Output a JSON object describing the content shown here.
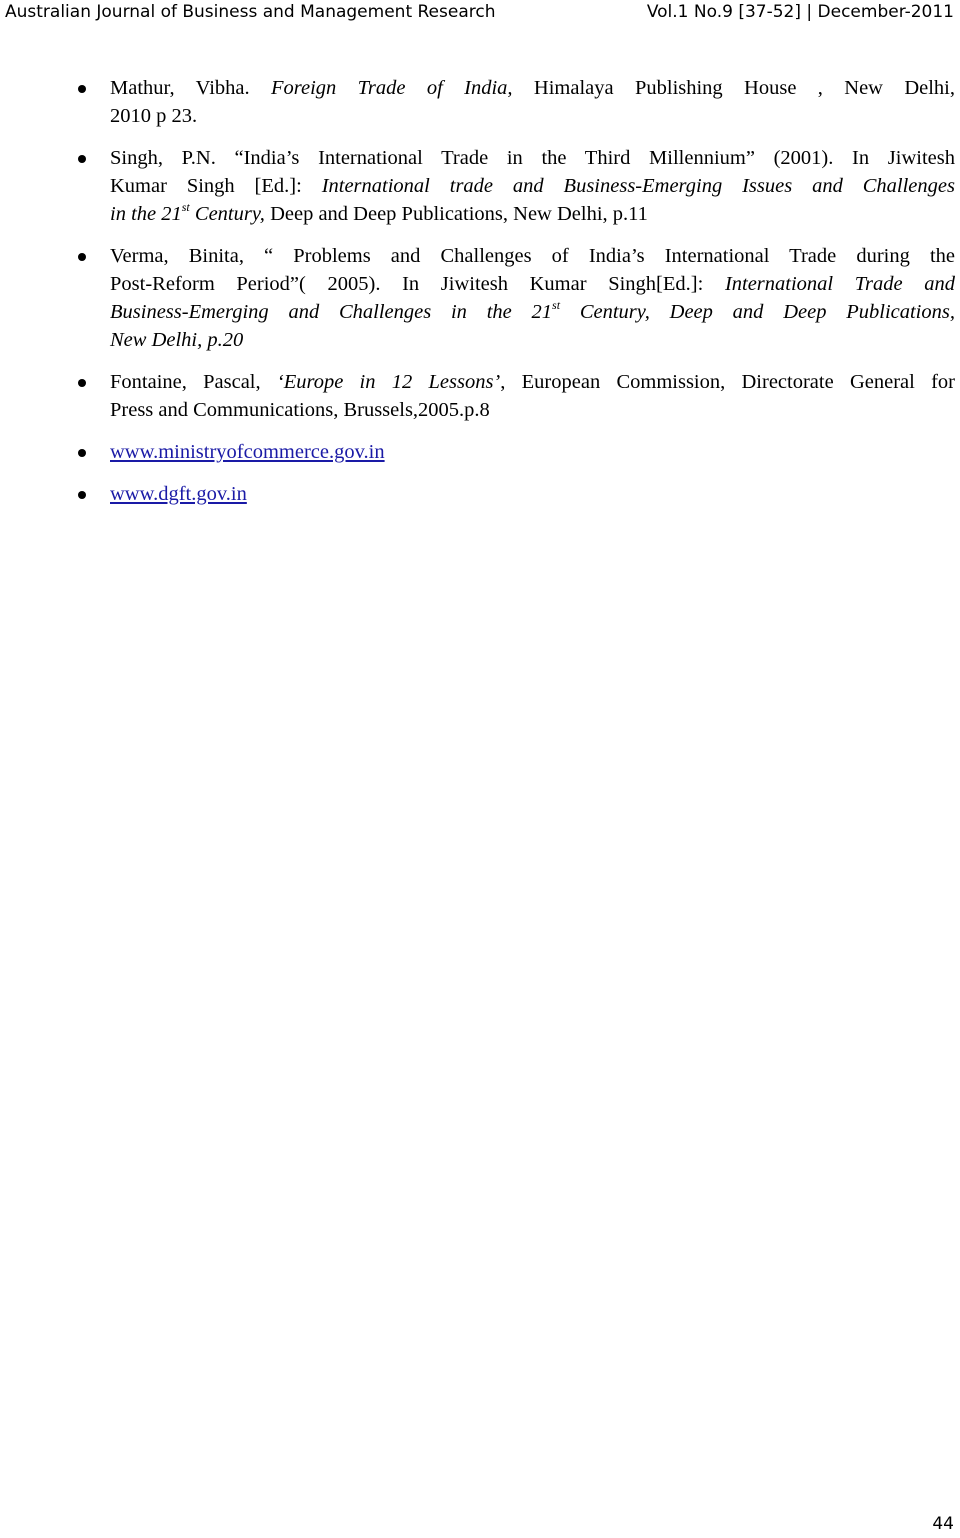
{
  "header": {
    "journal": "Australian Journal of Business and Management Research",
    "issue": "Vol.1 No.9 [37-52] | December-2011"
  },
  "references": [
    {
      "lines": [
        [
          {
            "t": "Mathur, Vibha. "
          },
          {
            "t": "Foreign Trade  of India,",
            "i": true
          },
          {
            "t": " Himalaya Publishing House , New Delhi,"
          }
        ],
        [
          {
            "t": "2010  p 23."
          }
        ]
      ]
    },
    {
      "lines": [
        [
          {
            "t": "Singh, P.N. “India’s International Trade in the Third Millennium” (2001). In Jiwitesh"
          }
        ],
        [
          {
            "t": "Kumar Singh [Ed.]: "
          },
          {
            "t": "International trade and Business-Emerging Issues and Challenges",
            "i": true
          }
        ],
        [
          {
            "t": "in the 21",
            "i": true
          },
          {
            "t": "st",
            "i": true,
            "s": true
          },
          {
            "t": " Century,",
            "i": true
          },
          {
            "t": " Deep and Deep Publications, New Delhi, p.11"
          }
        ]
      ]
    },
    {
      "lines": [
        [
          {
            "t": "Verma, Binita, “ Problems and Challenges of India’s International Trade during the"
          }
        ],
        [
          {
            "t": "Post-Reform Period”( 2005). In Jiwitesh Kumar Singh[Ed.]: "
          },
          {
            "t": "International Trade and",
            "i": true
          }
        ],
        [
          {
            "t": "Business-Emerging and Challenges in the 21",
            "i": true
          },
          {
            "t": "st",
            "i": true,
            "s": true
          },
          {
            "t": " Century, Deep and Deep Publications,",
            "i": true
          }
        ],
        [
          {
            "t": "New Delhi, p.20",
            "i": true
          }
        ]
      ]
    },
    {
      "lines": [
        [
          {
            "t": "Fontaine, Pascal, "
          },
          {
            "t": "‘Europe in 12 Lessons’",
            "i": true
          },
          {
            "t": ", European Commission, Directorate General for"
          }
        ],
        [
          {
            "t": "Press and Communications, Brussels,2005.p.8"
          }
        ]
      ]
    },
    {
      "lines": [
        [
          {
            "t": "www.ministryofcommerce.gov.in",
            "l": true
          }
        ]
      ]
    },
    {
      "lines": [
        [
          {
            "t": "www.dgft.gov.in",
            "l": true
          }
        ]
      ]
    }
  ],
  "page_number": "44",
  "colors": {
    "link": "#1a1aa6"
  }
}
